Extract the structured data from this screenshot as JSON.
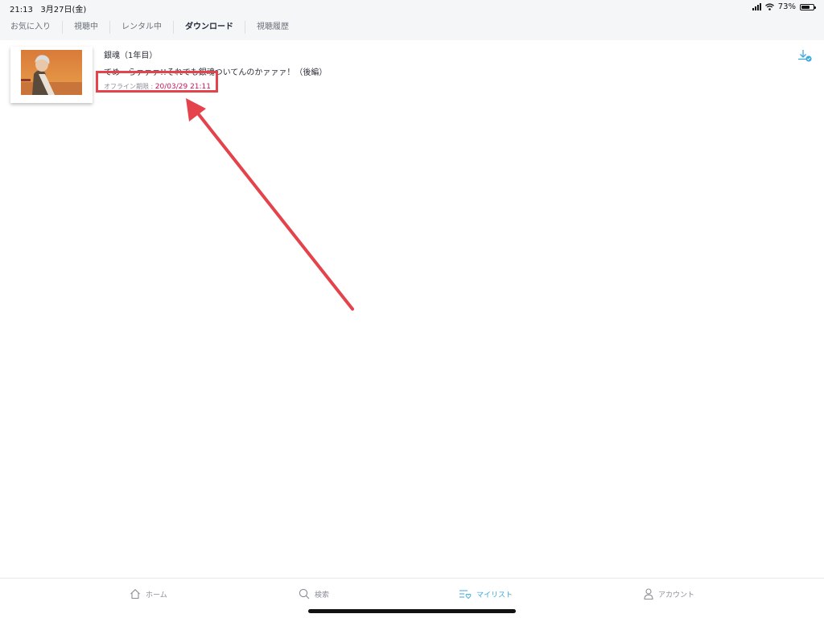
{
  "status_bar": {
    "time": "21:13",
    "date": "3月27日(金)",
    "battery_percent": "73%",
    "battery_level": 0.73
  },
  "tabs": [
    {
      "label": "お気に入り",
      "active": false
    },
    {
      "label": "視聴中",
      "active": false
    },
    {
      "label": "レンタル中",
      "active": false
    },
    {
      "label": "ダウンロード",
      "active": true
    },
    {
      "label": "視聴履歴",
      "active": false
    }
  ],
  "download_item": {
    "series_title": "銀魂（1年目）",
    "episode_title": "てめーらァァァ!!それでも銀魂ついてんのかァァァ！（後編）",
    "expiry_label": "オフライン期限 : ",
    "expiry_date": "20/03/29 21:11",
    "thumbnail_icon": "anime-thumbnail-image",
    "action_icon": "download-complete-icon"
  },
  "bottom_nav": [
    {
      "label": "ホーム",
      "icon": "home-icon",
      "active": false
    },
    {
      "label": "検索",
      "icon": "search-icon",
      "active": false
    },
    {
      "label": "マイリスト",
      "icon": "mylist-icon",
      "active": true
    },
    {
      "label": "アカウント",
      "icon": "account-icon",
      "active": false
    }
  ],
  "colors": {
    "accent": "#3aa7e0",
    "expiry_date": "#c2185b",
    "annotation": "#e5434b",
    "tab_background": "#f5f6f8"
  }
}
